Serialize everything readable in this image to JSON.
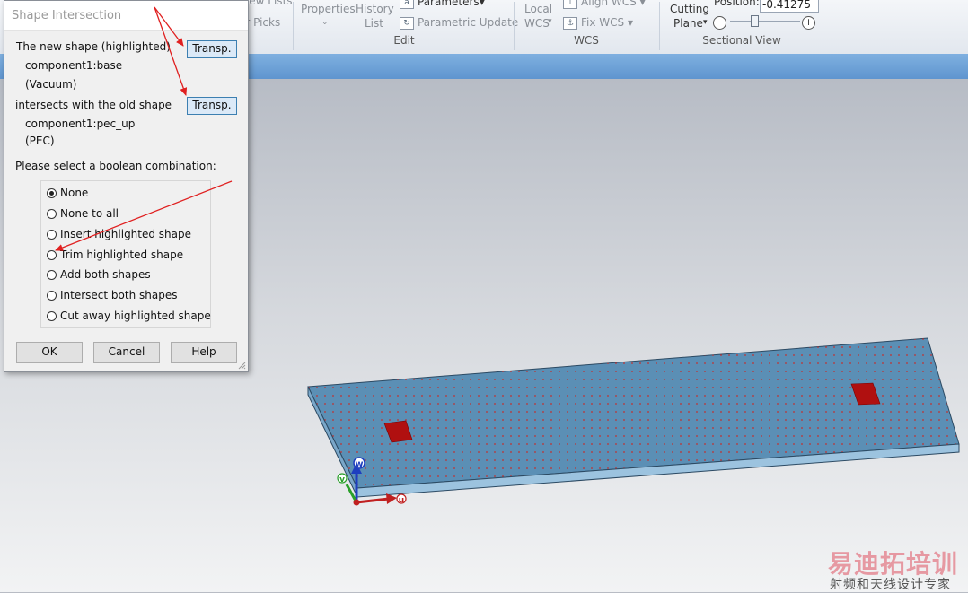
{
  "ribbon": {
    "top_row_items": [
      "View Lists",
      "Properties",
      "History",
      "Parameters",
      "Local",
      "Align WCS",
      "Cutting",
      "Position:"
    ],
    "partial_labels": [
      "ar Picks"
    ],
    "properties_label": "Properties",
    "history_label_1": "History",
    "history_label_2": "List",
    "parameters_label": "Parameters",
    "parametric_update_label": "Parametric Update",
    "local_wcs_label_1": "Local",
    "local_wcs_label_2": "WCS",
    "align_wcs_label": "Align WCS",
    "fix_wcs_label": "Fix WCS",
    "cutting_plane_label_1": "Cutting",
    "cutting_plane_label_2": "Plane",
    "position_label": "Position:",
    "position_value": "-0.41275",
    "groups": {
      "edit": "Edit",
      "wcs": "WCS",
      "sectional_view": "Sectional View"
    },
    "minus_glyph": "−",
    "plus_glyph": "+"
  },
  "dialog": {
    "title": "Shape Intersection",
    "new_shape_text": "The new shape (highlighted)",
    "new_shape_name": "component1:base",
    "new_shape_material": "(Vacuum)",
    "intersects_text": "intersects with the old shape",
    "old_shape_name": "component1:pec_up",
    "old_shape_material": "(PEC)",
    "transp_label": "Transp.",
    "prompt": "Please select a boolean combination:",
    "options": [
      "None",
      "None to all",
      "Insert highlighted shape",
      "Trim highlighted shape",
      "Add both shapes",
      "Intersect both shapes",
      "Cut away highlighted shape"
    ],
    "selected_option": "None",
    "ok_label": "OK",
    "cancel_label": "Cancel",
    "help_label": "Help"
  },
  "axes": {
    "w": "w",
    "v": "v",
    "u": "u"
  },
  "colors": {
    "slab": "#5b8fb5",
    "pec_patch": "#b01010",
    "annotation_arrow": "#e02020",
    "transp_button": "#dbe9f7"
  },
  "watermark": {
    "main": "易迪拓培训",
    "sub": "射频和天线设计专家"
  }
}
